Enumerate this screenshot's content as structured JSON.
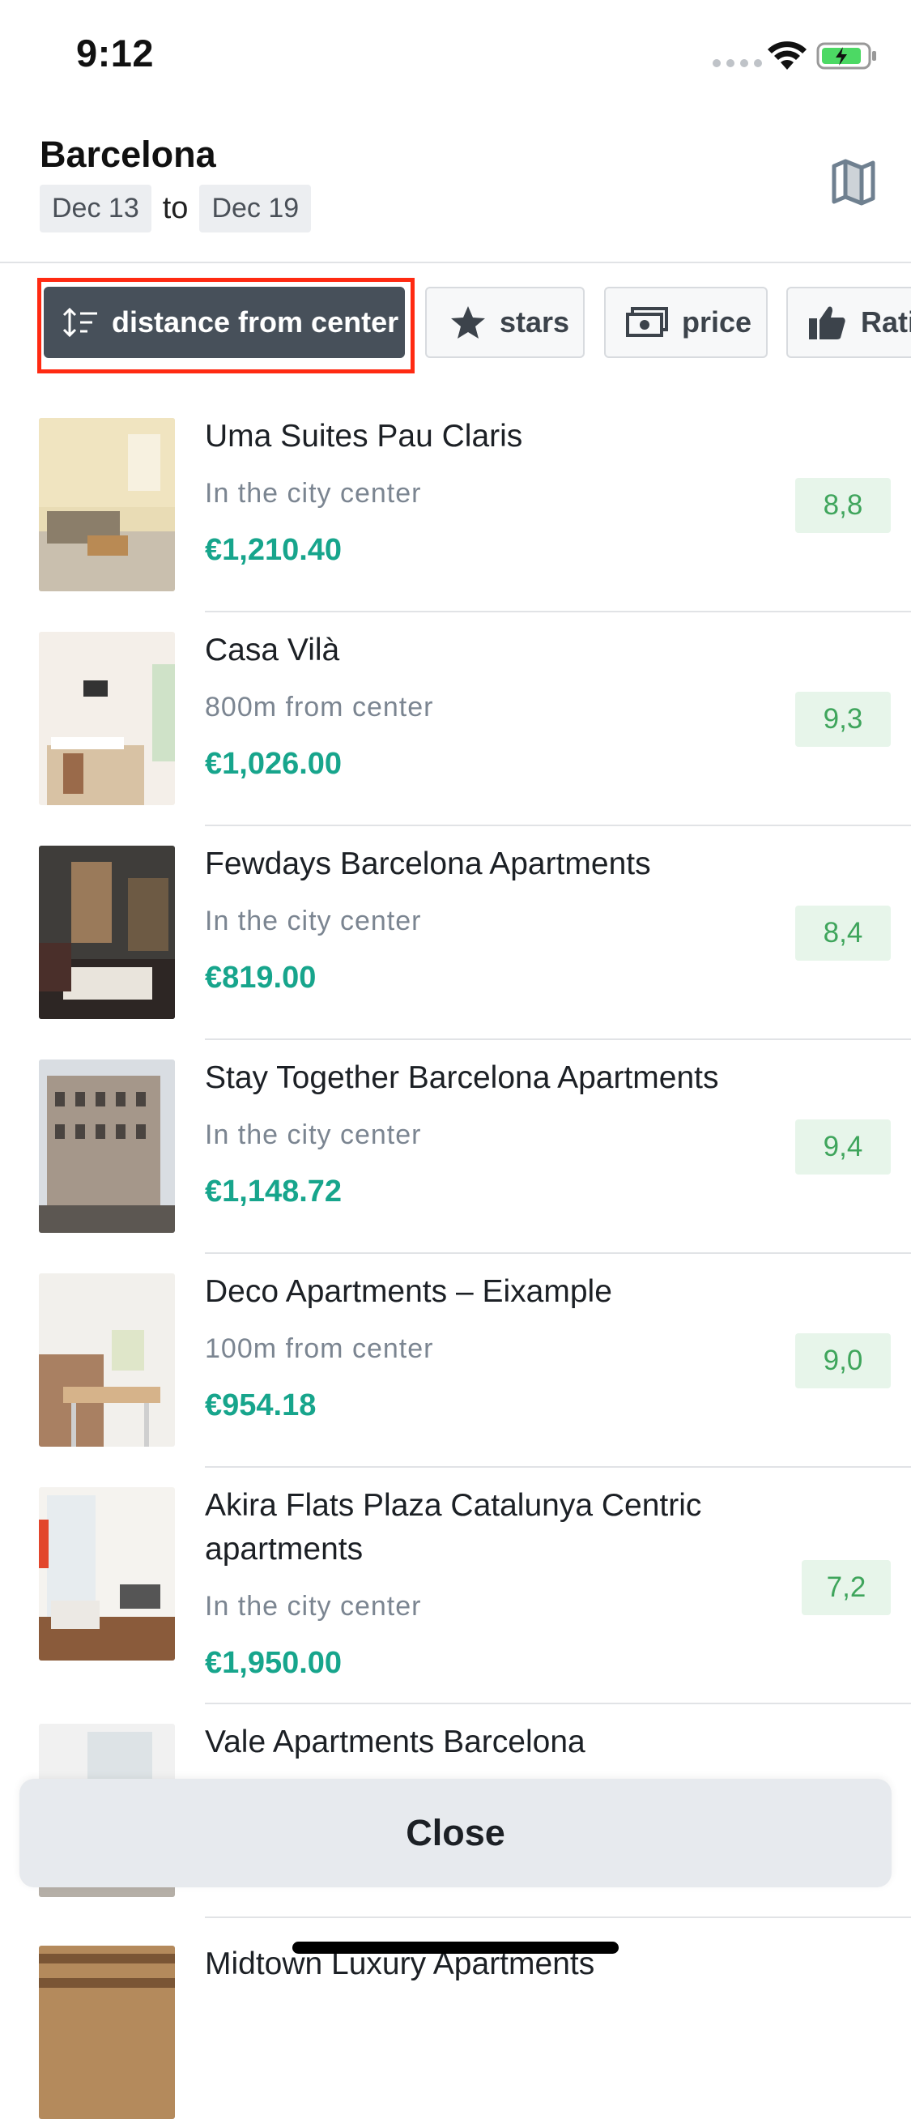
{
  "status_bar": {
    "time": "9:12"
  },
  "header": {
    "city": "Barcelona",
    "check_in": "Dec 13",
    "separator": "to",
    "check_out": "Dec 19"
  },
  "filters": [
    {
      "label": "distance from center",
      "icon": "sort-icon",
      "active": true
    },
    {
      "label": "stars",
      "icon": "star-icon",
      "active": false
    },
    {
      "label": "price",
      "icon": "money-icon",
      "active": false
    },
    {
      "label": "Rati",
      "icon": "thumbs-up-icon",
      "active": false
    }
  ],
  "hotels": [
    {
      "name": "Uma Suites Pau Claris",
      "location": "In the city center",
      "price": "€1,210.40",
      "score": "8,8"
    },
    {
      "name": "Casa Vilà",
      "location": "800m from center",
      "price": "€1,026.00",
      "score": "9,3"
    },
    {
      "name": "Fewdays Barcelona Apartments",
      "location": "In the city center",
      "price": "€819.00",
      "score": "8,4"
    },
    {
      "name": "Stay Together Barcelona Apartments",
      "location": "In the city center",
      "price": "€1,148.72",
      "score": "9,4"
    },
    {
      "name": "Deco Apartments – Eixample",
      "location": "100m from center",
      "price": "€954.18",
      "score": "9,0"
    },
    {
      "name": "Akira Flats Plaza Catalunya Centric apartments",
      "location": "In the city center",
      "price": "€1,950.00",
      "score": "7,2"
    },
    {
      "name": "Vale Apartments Barcelona"
    },
    {
      "name": "Midtown Luxury Apartments"
    }
  ],
  "close_label": "Close",
  "colors": {
    "price": "#17a58c",
    "score_bg": "#e7f5ea",
    "score_text": "#3fa55c",
    "active_chip": "#47505a",
    "highlight": "#ff2a12"
  }
}
